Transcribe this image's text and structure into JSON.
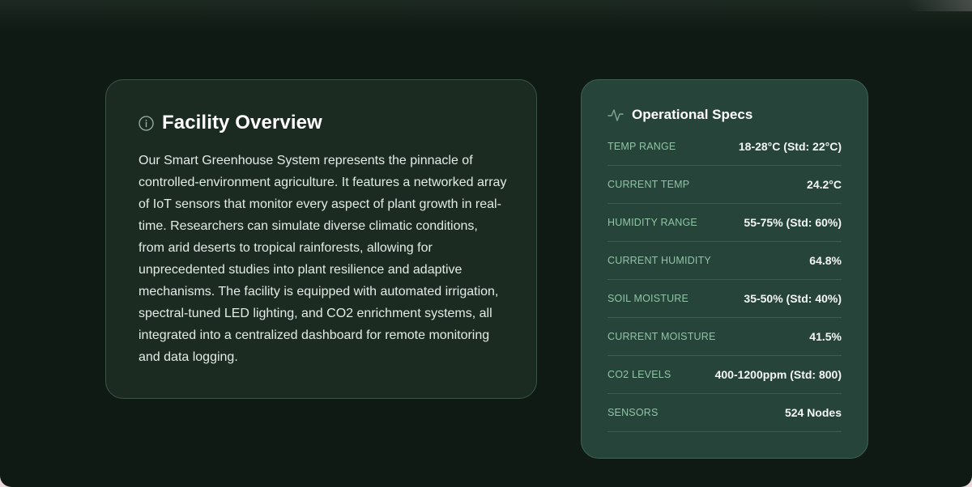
{
  "overview": {
    "icon": "info-icon",
    "title": "Facility Overview",
    "description": "Our Smart Greenhouse System represents the pinnacle of controlled-environment agriculture. It features a networked array of IoT sensors that monitor every aspect of plant growth in real-time. Researchers can simulate diverse climatic conditions, from arid deserts to tropical rainforests, allowing for unprecedented studies into plant resilience and adaptive mechanisms. The facility is equipped with automated irrigation, spectral-tuned LED lighting, and CO2 enrichment systems, all integrated into a centralized dashboard for remote monitoring and data logging."
  },
  "specs": {
    "icon": "activity-pulse-icon",
    "title": "Operational Specs",
    "rows": [
      {
        "label": "TEMP RANGE",
        "value": "18-28°C (Std: 22°C)"
      },
      {
        "label": "CURRENT TEMP",
        "value": "24.2°C"
      },
      {
        "label": "HUMIDITY RANGE",
        "value": "55-75% (Std: 60%)"
      },
      {
        "label": "CURRENT HUMIDITY",
        "value": "64.8%"
      },
      {
        "label": "SOIL MOISTURE",
        "value": "35-50% (Std: 40%)"
      },
      {
        "label": "CURRENT MOISTURE",
        "value": "41.5%"
      },
      {
        "label": "CO2 LEVELS",
        "value": "400-1200ppm (Std: 800)"
      },
      {
        "label": "SENSORS",
        "value": "524 Nodes"
      }
    ]
  },
  "colors": {
    "background": "#0f1a15",
    "overview_card": "#1b2b22",
    "specs_card": "#27443a",
    "accent_label": "#8fc4a6"
  }
}
